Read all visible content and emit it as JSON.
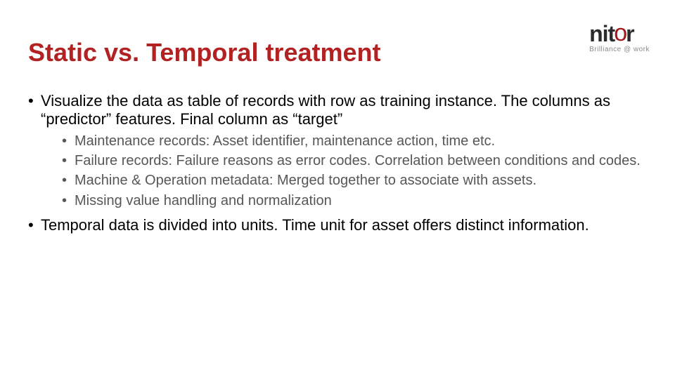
{
  "logo": {
    "brand_n": "n",
    "brand_i": "i",
    "brand_t": "t",
    "brand_o": "o",
    "brand_r": "r",
    "tagline": "Brilliance @ work"
  },
  "title": "Static vs. Temporal treatment",
  "bullets": [
    {
      "text": "Visualize the data as table of records with row as training instance. The columns as “predictor” features. Final column as “target”",
      "sub": [
        "Maintenance records: Asset identifier, maintenance action, time etc.",
        "Failure records: Failure reasons as error codes. Correlation between conditions and codes.",
        "Machine & Operation metadata: Merged together to associate with assets.",
        "Missing value handling and normalization"
      ]
    },
    {
      "text": "Temporal data is divided into units. Time unit for asset offers distinct information.",
      "sub": []
    }
  ]
}
